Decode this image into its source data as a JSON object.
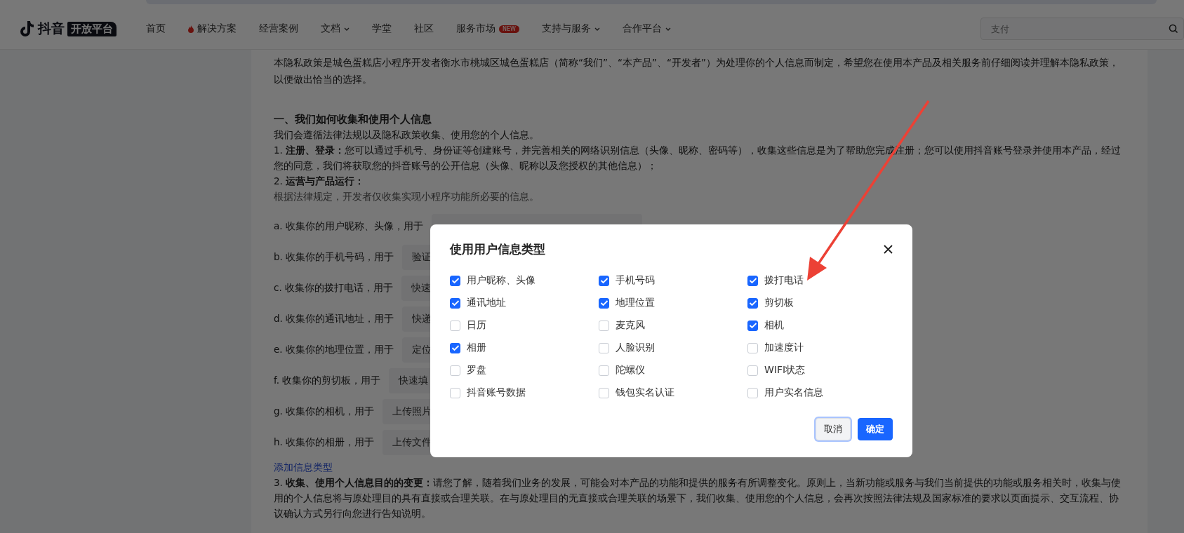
{
  "header": {
    "logo_text": "抖音",
    "logo_badge": "开放平台",
    "nav": [
      {
        "label": "首页",
        "kind": "plain",
        "dropdown": false
      },
      {
        "label": "解决方案",
        "kind": "hot",
        "dropdown": false
      },
      {
        "label": "经营案例",
        "kind": "plain",
        "dropdown": false
      },
      {
        "label": "文档",
        "kind": "plain",
        "dropdown": true
      },
      {
        "label": "学堂",
        "kind": "plain",
        "dropdown": false
      },
      {
        "label": "社区",
        "kind": "plain",
        "dropdown": false
      },
      {
        "label": "服务市场",
        "kind": "plain",
        "dropdown": false,
        "badge": "NEW"
      },
      {
        "label": "支持与服务",
        "kind": "plain",
        "dropdown": true
      },
      {
        "label": "合作平台",
        "kind": "plain",
        "dropdown": true
      }
    ],
    "search": {
      "placeholder": "支付"
    }
  },
  "document": {
    "intro": "本隐私政策是城色蛋糕店小程序开发者衡水市桃城区城色蛋糕店（简称“我们”、“本产品”、“开发者”）为处理你的个人信息而制定，希望您在使用本产品及相关服务前仔细阅读并理解本隐私政策，以便做出恰当的选择。",
    "heading": "一、我们如何收集和使用个人信息",
    "paragraphs": [
      "我们会遵循法律法规以及隐私政策收集、使用您的个人信息。",
      "1. **注册、登录：**您可以通过手机号、身份证等创建账号，并完善相关的网络识别信息（头像、昵称、密码等），收集这些信息是为了帮助您完成注册；您可以使用抖音账号登录并使用本产品，经过您的同意，我们将获取您的抖音账号的公开信息（头像、昵称以及您授权的其他信息）；",
      "2. **运营与产品运行：**"
    ],
    "note": "根据法律规定，开发者仅收集实现小程序功能所必要的信息。",
    "rows": [
      {
        "label": "a. 收集你的用户昵称、头像，用于",
        "value": ""
      },
      {
        "label": "b. 收集你的手机号码，用于",
        "value": "验证"
      },
      {
        "label": "c. 收集你的拨打电话，用于",
        "value": "快速"
      },
      {
        "label": "d. 收集你的通讯地址，用于",
        "value": "快递"
      },
      {
        "label": "e. 收集你的地理位置，用于",
        "value": "定位"
      },
      {
        "label": "f. 收集你的剪切板，用于",
        "value": "快速填"
      },
      {
        "label": "g. 收集你的相机，用于",
        "value": "上传照片"
      },
      {
        "label": "h. 收集你的相册，用于",
        "value": "上传文件"
      }
    ],
    "add_link": "添加信息类型",
    "closing": "3. **收集、使用个人信息目的的变更：**请您了解，随着我们业务的发展，可能会对本产品的功能和提供的服务有所调整变化。原则上，当新功能或服务与我们当前提供的功能或服务相关时，收集与使用的个人信息将与原处理目的具有直接或合理关联。在与原处理目的无直接或合理关联的场景下，我们收集、使用您的个人信息，会再次按照法律法规及国家标准的要求以页面提示、交互流程、协议确认方式另行向您进行告知说明。"
  },
  "dialog": {
    "title": "使用用户信息类型",
    "options": [
      {
        "label": "用户昵称、头像",
        "checked": true
      },
      {
        "label": "手机号码",
        "checked": true
      },
      {
        "label": "拨打电话",
        "checked": true
      },
      {
        "label": "通讯地址",
        "checked": true
      },
      {
        "label": "地理位置",
        "checked": true
      },
      {
        "label": "剪切板",
        "checked": true
      },
      {
        "label": "日历",
        "checked": false
      },
      {
        "label": "麦克风",
        "checked": false
      },
      {
        "label": "相机",
        "checked": true
      },
      {
        "label": "相册",
        "checked": true
      },
      {
        "label": "人脸识别",
        "checked": false
      },
      {
        "label": "加速度计",
        "checked": false
      },
      {
        "label": "罗盘",
        "checked": false
      },
      {
        "label": "陀螺仪",
        "checked": false
      },
      {
        "label": "WIFI状态",
        "checked": false
      },
      {
        "label": "抖音账号数据",
        "checked": false
      },
      {
        "label": "钱包实名认证",
        "checked": false
      },
      {
        "label": "用户实名信息",
        "checked": false
      }
    ],
    "buttons": [
      {
        "label": "取消",
        "kind": "secondary",
        "focused": true
      },
      {
        "label": "确定",
        "kind": "primary",
        "focused": false
      }
    ]
  }
}
